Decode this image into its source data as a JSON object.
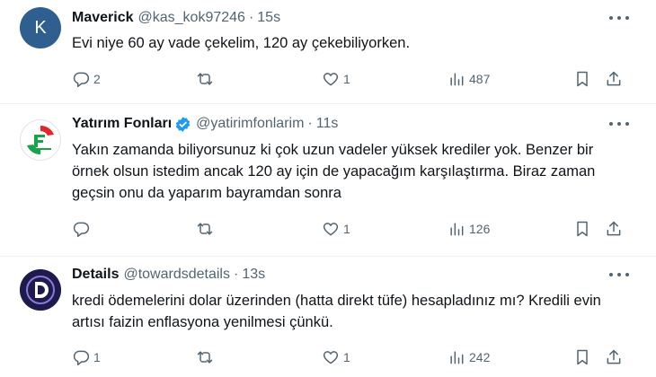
{
  "tweets": [
    {
      "avatar_letter": "K",
      "name": "Maverick",
      "handle": "@kas_kok97246",
      "separator": "·",
      "time": "15s",
      "text": "Evi niye 60 ay vade çekelim, 120 ay çekebiliyorken.",
      "replies": "2",
      "retweets": "",
      "likes": "1",
      "views": "487"
    },
    {
      "name": "Yatırım Fonları",
      "handle": "@yatirimfonlarim",
      "separator": "·",
      "time": "11s",
      "text": "Yakın zamanda biliyorsunuz ki çok uzun vadeler yüksek krediler yok. Benzer bir örnek olsun istedim ancak 120 ay için de yapacağım karşılaştırma. Biraz zaman geçsin onu da yaparım bayramdan sonra",
      "replies": "",
      "retweets": "",
      "likes": "1",
      "views": "126"
    },
    {
      "name": "Details",
      "handle": "@towardsdetails",
      "separator": "·",
      "time": "13s",
      "text": "kredi ödemelerini dolar üzerinden (hatta direkt tüfe) hesapladınız mı? Kredili evin artısı faizin enflasyona yenilmesi çünkü.",
      "replies": "1",
      "retweets": "",
      "likes": "1",
      "views": "242"
    }
  ],
  "colors": {
    "accent": "#1d9bf0",
    "secondary_text": "#536471",
    "primary_text": "#0f1419",
    "avatar_k_bg": "#2f5f8f",
    "avatar_d_bg": "#1d1a4e"
  },
  "icons": [
    "more-icon",
    "reply-icon",
    "retweet-icon",
    "like-icon",
    "views-icon",
    "bookmark-icon",
    "share-icon",
    "verified-badge-icon"
  ]
}
